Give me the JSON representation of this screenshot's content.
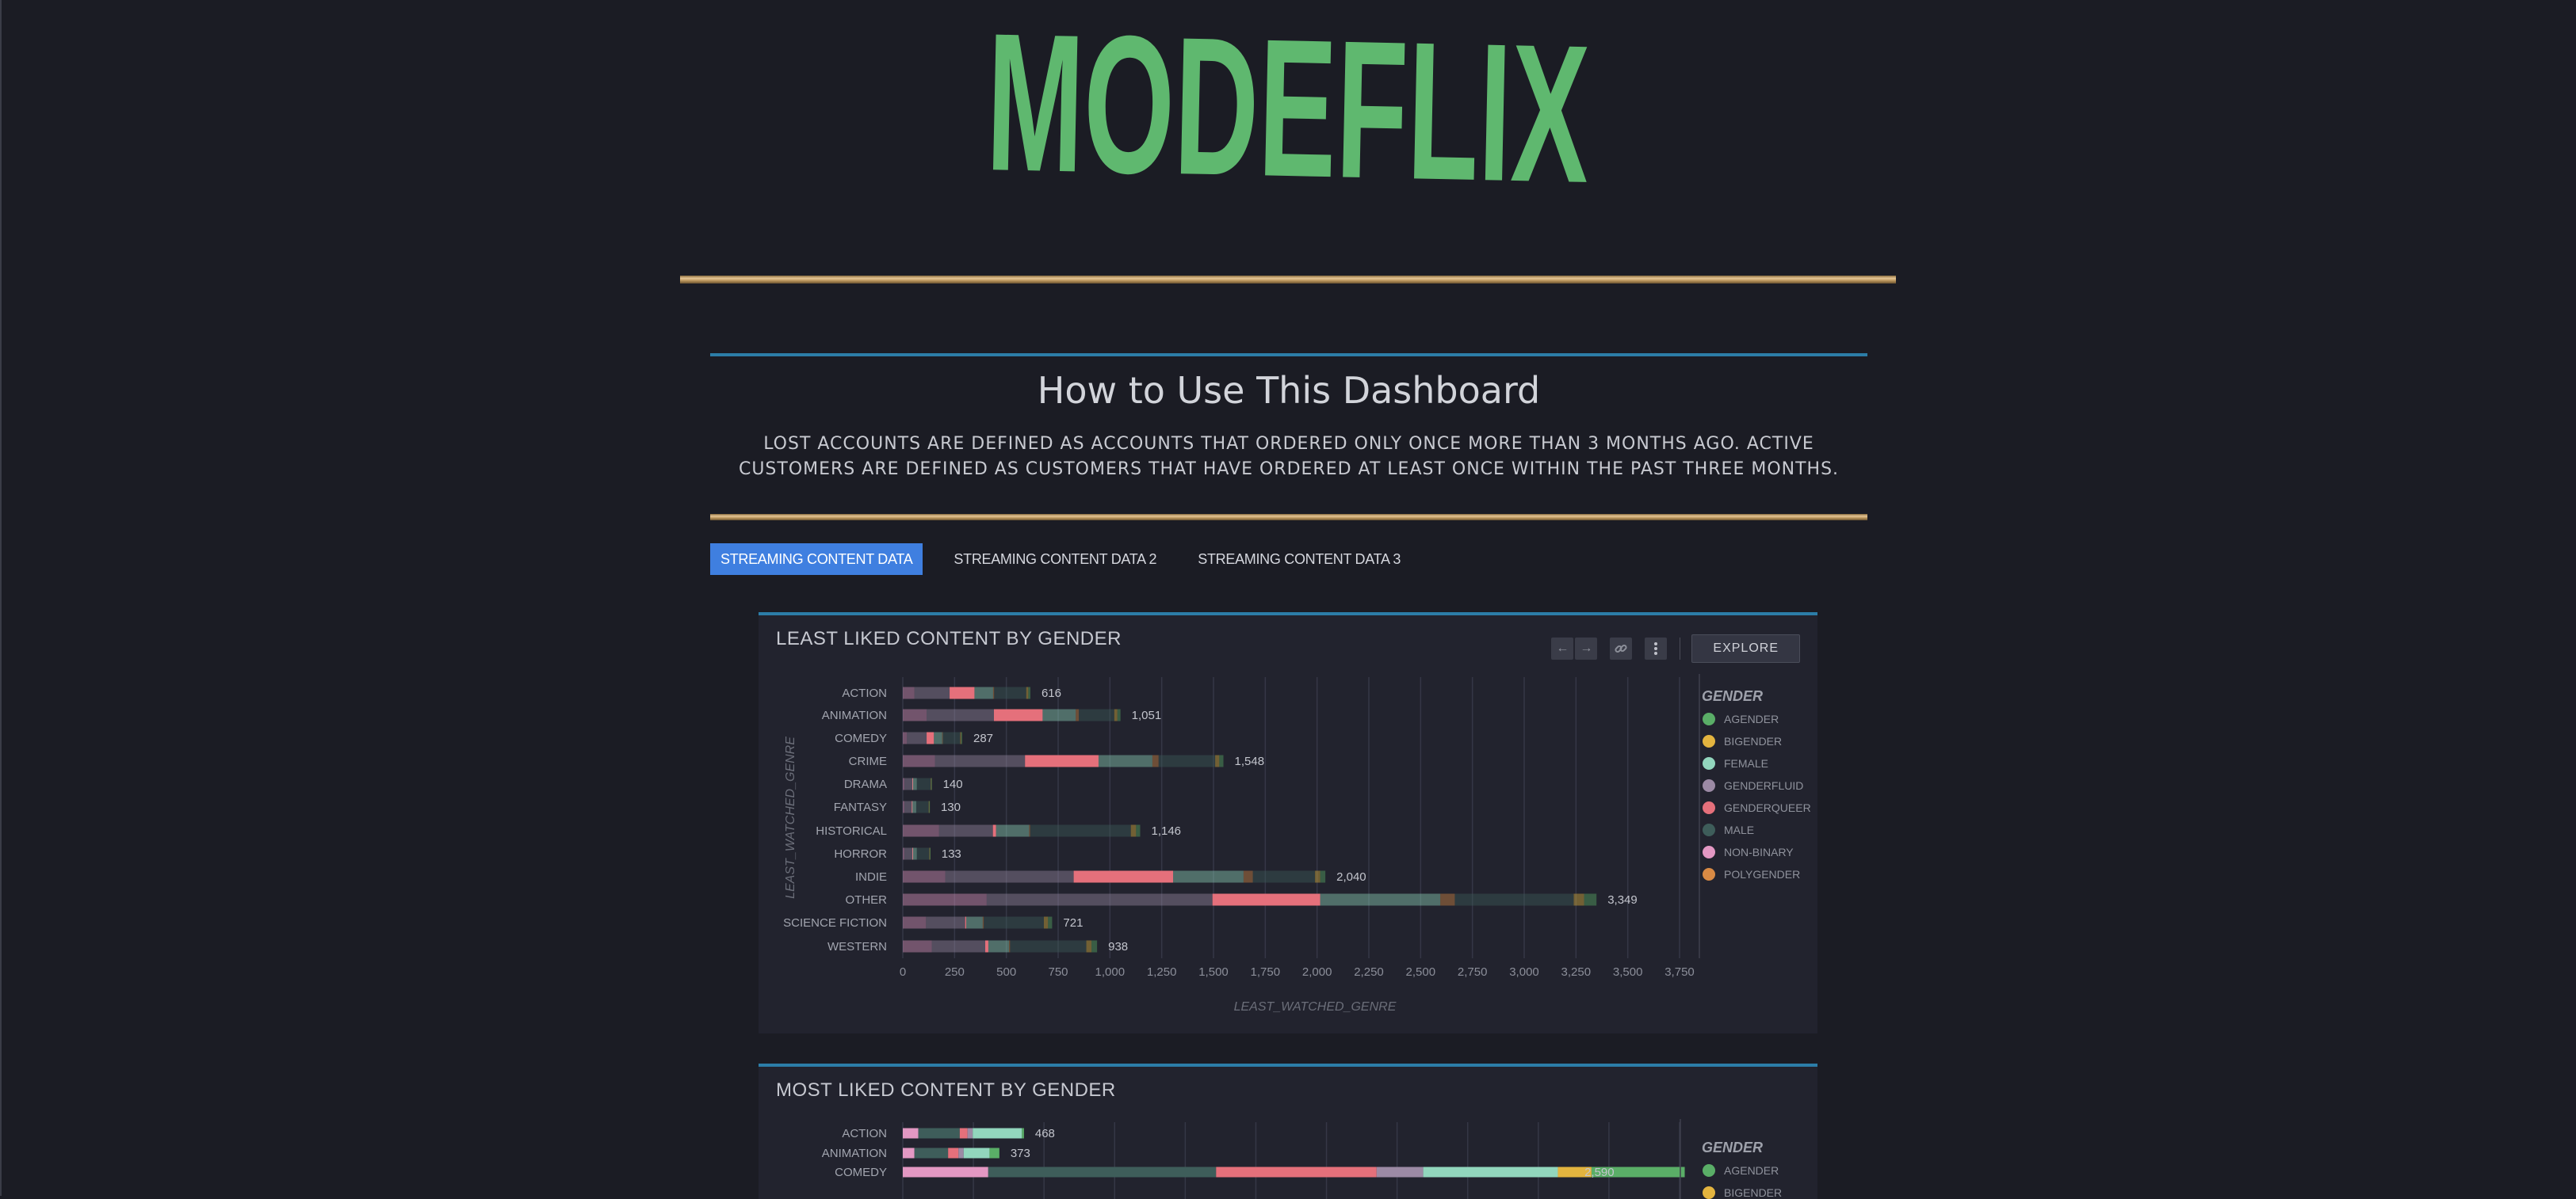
{
  "app": {
    "brand": "MODEFLIX",
    "brand_color": "#5fb86f"
  },
  "intro": {
    "title": "How to Use This Dashboard",
    "text": "LOST ACCOUNTS ARE DEFINED AS ACCOUNTS THAT ORDERED ONLY ONCE MORE THAN 3 MONTHS AGO. ACTIVE CUSTOMERS ARE DEFINED AS CUSTOMERS THAT HAVE ORDERED AT LEAST ONCE WITHIN THE PAST THREE MONTHS."
  },
  "tabs": [
    {
      "label": "STREAMING CONTENT DATA",
      "active": true
    },
    {
      "label": "STREAMING CONTENT DATA 2",
      "active": false
    },
    {
      "label": "STREAMING CONTENT DATA 3",
      "active": false
    }
  ],
  "toolbar": {
    "explore_label": "EXPLORE",
    "icons": [
      "arrow-left-icon",
      "arrow-right-icon",
      "link-icon",
      "more-vertical-icon"
    ]
  },
  "colors": {
    "AGENDER": "#5aae67",
    "BIGENDER": "#e3b43f",
    "FEMALE": "#92d6bd",
    "GENDERFLUID": "#9c8aa5",
    "GENDERQUEER": "#e5707b",
    "MALE": "#3e5d5a",
    "NON-BINARY": "#e398c3",
    "POLYGENDER": "#d98a44"
  },
  "chart_data": [
    {
      "type": "bar",
      "orientation": "horizontal",
      "stacked": true,
      "title": "LEAST LIKED CONTENT BY GENDER",
      "xlabel": "LEAST_WATCHED_GENRE",
      "ylabel": "LEAST_WATCHED_GENRE",
      "xlim": [
        0,
        3750
      ],
      "xticks": [
        0,
        250,
        500,
        750,
        1000,
        1250,
        1500,
        1750,
        2000,
        2250,
        2500,
        2750,
        3000,
        3250,
        3500,
        3750
      ],
      "xtick_labels": [
        "0",
        "250",
        "500",
        "750",
        "1,000",
        "1,250",
        "1,500",
        "1,750",
        "2,000",
        "2,250",
        "2,500",
        "2,750",
        "3,000",
        "3,250",
        "3,500",
        "3,750"
      ],
      "legend_title": "GENDER",
      "legend": [
        "AGENDER",
        "BIGENDER",
        "FEMALE",
        "GENDERFLUID",
        "GENDERQUEER",
        "MALE",
        "NON-BINARY",
        "POLYGENDER"
      ],
      "legend_position": "right",
      "highlighted_series": "GENDERQUEER",
      "categories": [
        "ACTION",
        "ANIMATION",
        "COMEDY",
        "CRIME",
        "DRAMA",
        "FANTASY",
        "HISTORICAL",
        "HORROR",
        "INDIE",
        "OTHER",
        "SCIENCE FICTION",
        "WESTERN"
      ],
      "totals": [
        616,
        1051,
        287,
        1548,
        140,
        130,
        1146,
        133,
        2040,
        3349,
        721,
        938
      ],
      "total_labels": [
        "616",
        "1,051",
        "287",
        "1,548",
        "140",
        "130",
        "1,146",
        "133",
        "2,040",
        "3,349",
        "721",
        "938"
      ],
      "series": [
        {
          "name": "NON-BINARY",
          "values": [
            56,
            115,
            20,
            155,
            8,
            8,
            175,
            8,
            205,
            405,
            112,
            140
          ]
        },
        {
          "name": "GENDERFLUID",
          "values": [
            170,
            325,
            95,
            435,
            38,
            35,
            260,
            38,
            620,
            1090,
            189,
            258
          ]
        },
        {
          "name": "GENDERQUEER",
          "values": [
            120,
            235,
            35,
            355,
            2,
            2,
            15,
            2,
            480,
            520,
            5,
            15
          ]
        },
        {
          "name": "FEMALE",
          "values": [
            90,
            160,
            40,
            260,
            20,
            20,
            160,
            20,
            340,
            580,
            80,
            100
          ]
        },
        {
          "name": "POLYGENDER",
          "values": [
            5,
            15,
            2,
            30,
            0,
            0,
            5,
            0,
            45,
            70,
            5,
            5
          ]
        },
        {
          "name": "MALE",
          "values": [
            155,
            171,
            85,
            273,
            67,
            60,
            486,
            60,
            300,
            574,
            290,
            368
          ]
        },
        {
          "name": "BIGENDER",
          "values": [
            10,
            15,
            5,
            20,
            2,
            2,
            25,
            2,
            25,
            50,
            20,
            25
          ]
        },
        {
          "name": "AGENDER",
          "values": [
            10,
            15,
            5,
            20,
            3,
            3,
            20,
            3,
            25,
            60,
            20,
            27
          ]
        }
      ]
    },
    {
      "type": "bar",
      "orientation": "horizontal",
      "stacked": true,
      "title": "MOST LIKED CONTENT BY GENDER",
      "xlim": [
        0,
        3000
      ],
      "legend_title": "GENDER",
      "legend": [
        "AGENDER",
        "BIGENDER"
      ],
      "legend_position": "right",
      "categories": [
        "ACTION",
        "ANIMATION",
        "COMEDY"
      ],
      "totals": [
        468,
        373,
        2590
      ],
      "total_labels": [
        "468",
        "373",
        "2,590"
      ],
      "series": [
        {
          "name": "NON-BINARY",
          "values": [
            60,
            45,
            330
          ]
        },
        {
          "name": "MALE",
          "values": [
            160,
            130,
            880
          ]
        },
        {
          "name": "GENDERQUEER",
          "values": [
            30,
            40,
            620
          ]
        },
        {
          "name": "GENDERFLUID",
          "values": [
            20,
            20,
            180
          ]
        },
        {
          "name": "FEMALE",
          "values": [
            190,
            100,
            520
          ]
        },
        {
          "name": "BIGENDER",
          "values": [
            0,
            0,
            130
          ]
        },
        {
          "name": "AGENDER",
          "values": [
            8,
            38,
            360
          ]
        }
      ]
    }
  ]
}
